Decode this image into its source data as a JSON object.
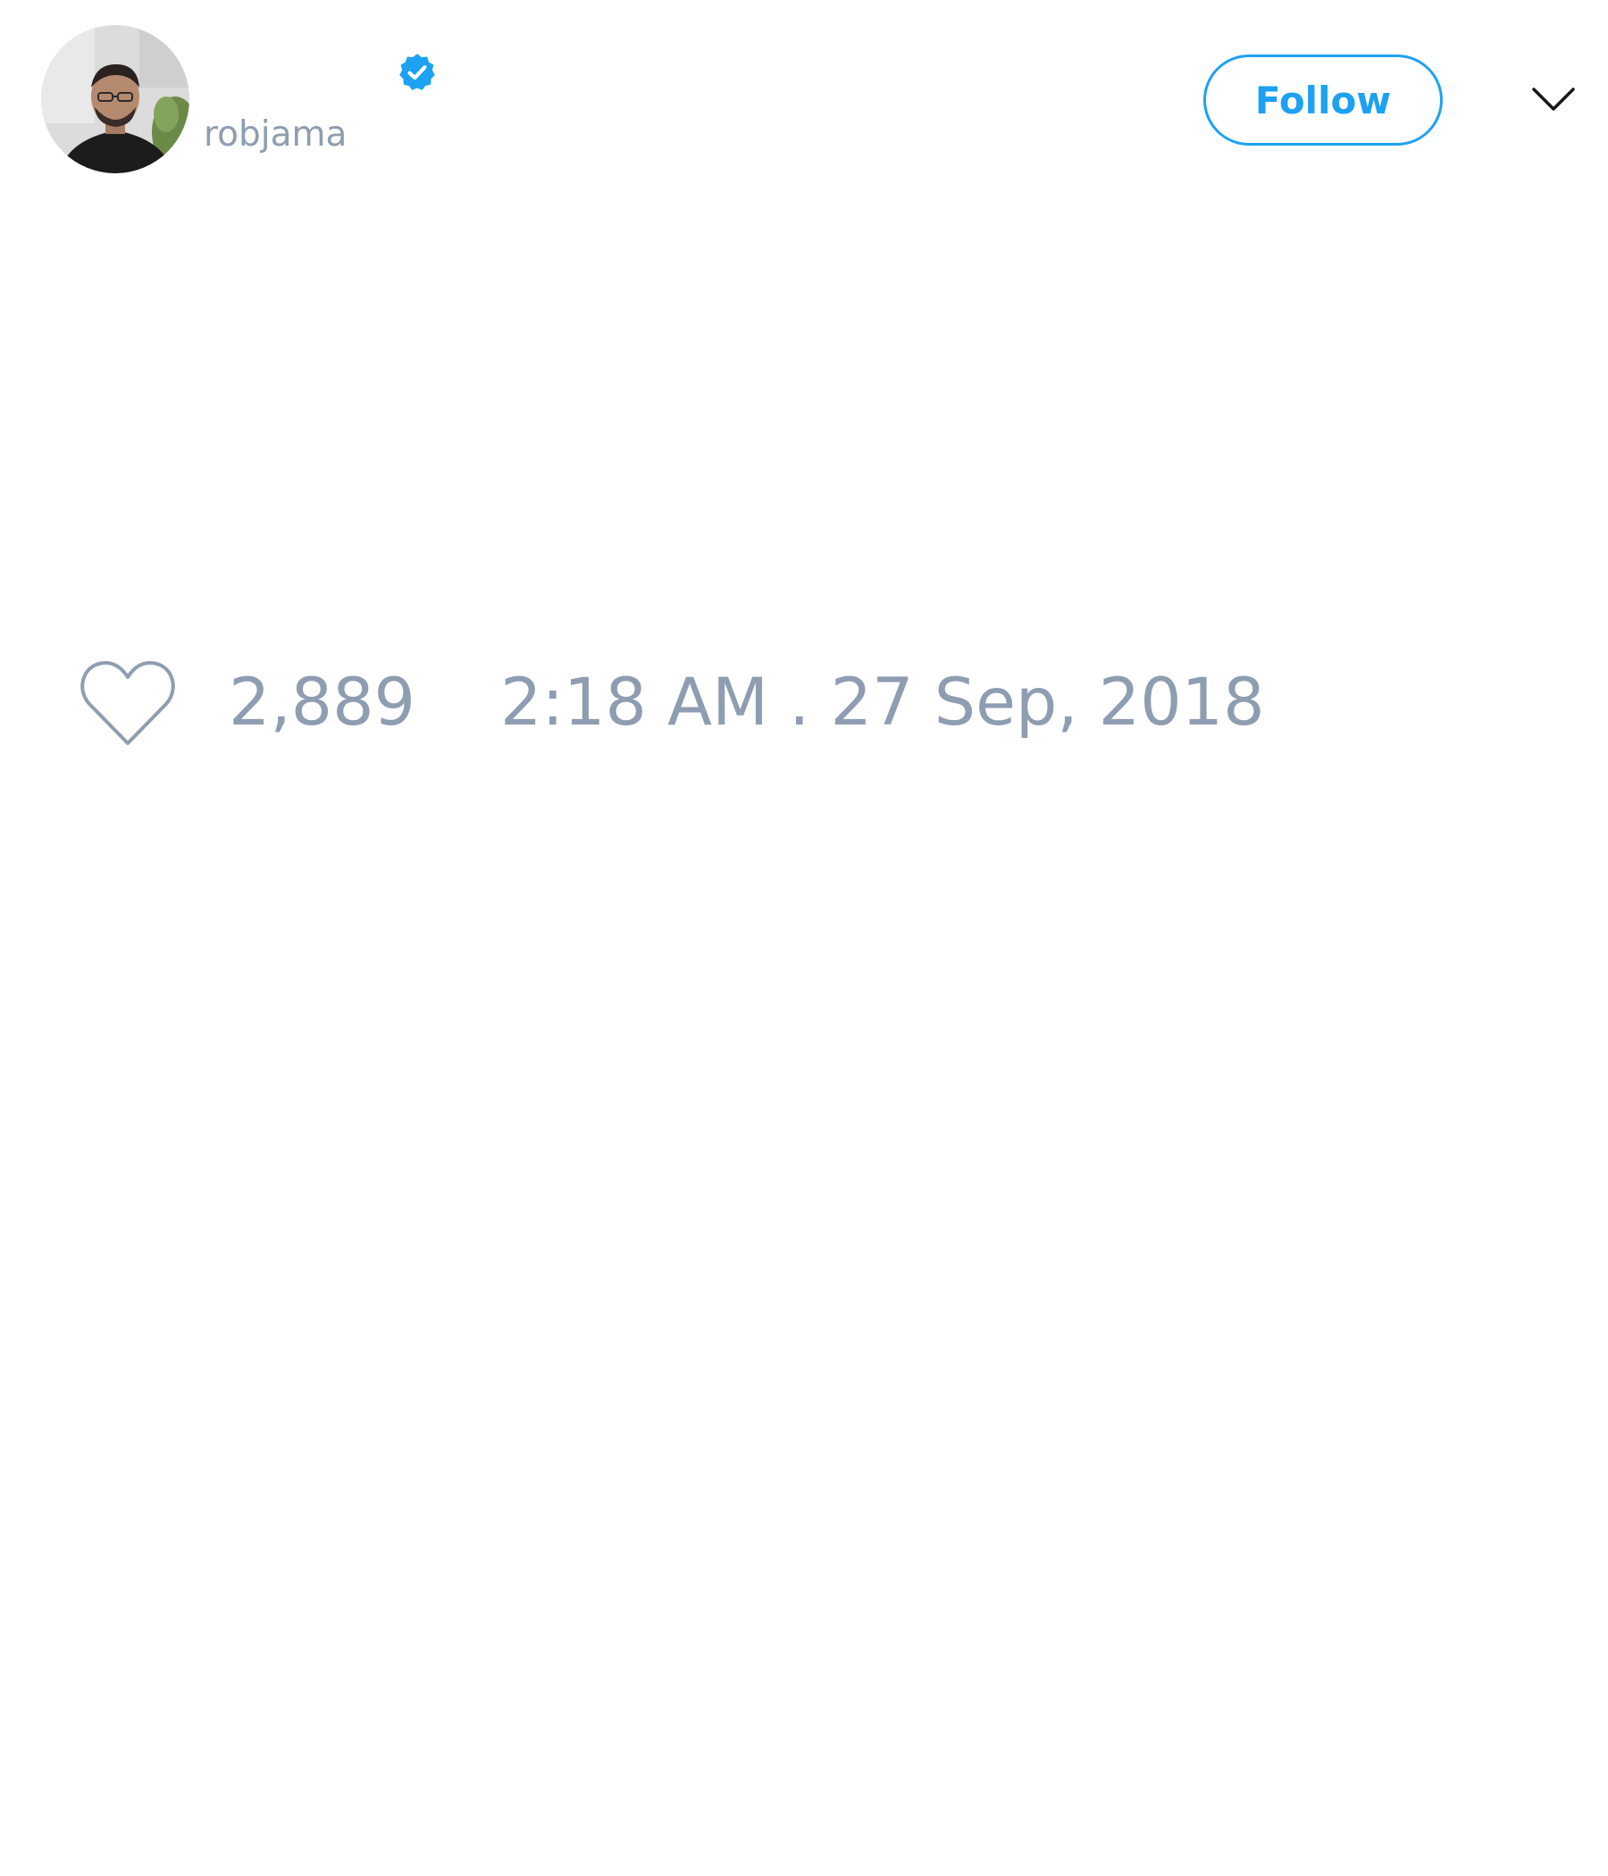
{
  "author": {
    "avatar_alt": "avatar",
    "handle": "robjama",
    "verified": true,
    "verified_icon": "verified-badge-icon"
  },
  "header": {
    "follow_label": "Follow",
    "menu_icon": "chevron-down-icon"
  },
  "stats": {
    "like_icon": "heart-icon",
    "like_count": "2,889",
    "timestamp": "2:18 AM . 27 Sep, 2018"
  },
  "colors": {
    "accent": "#1da1f2",
    "muted_text": "#8e9db1",
    "background": "#ffffff"
  }
}
